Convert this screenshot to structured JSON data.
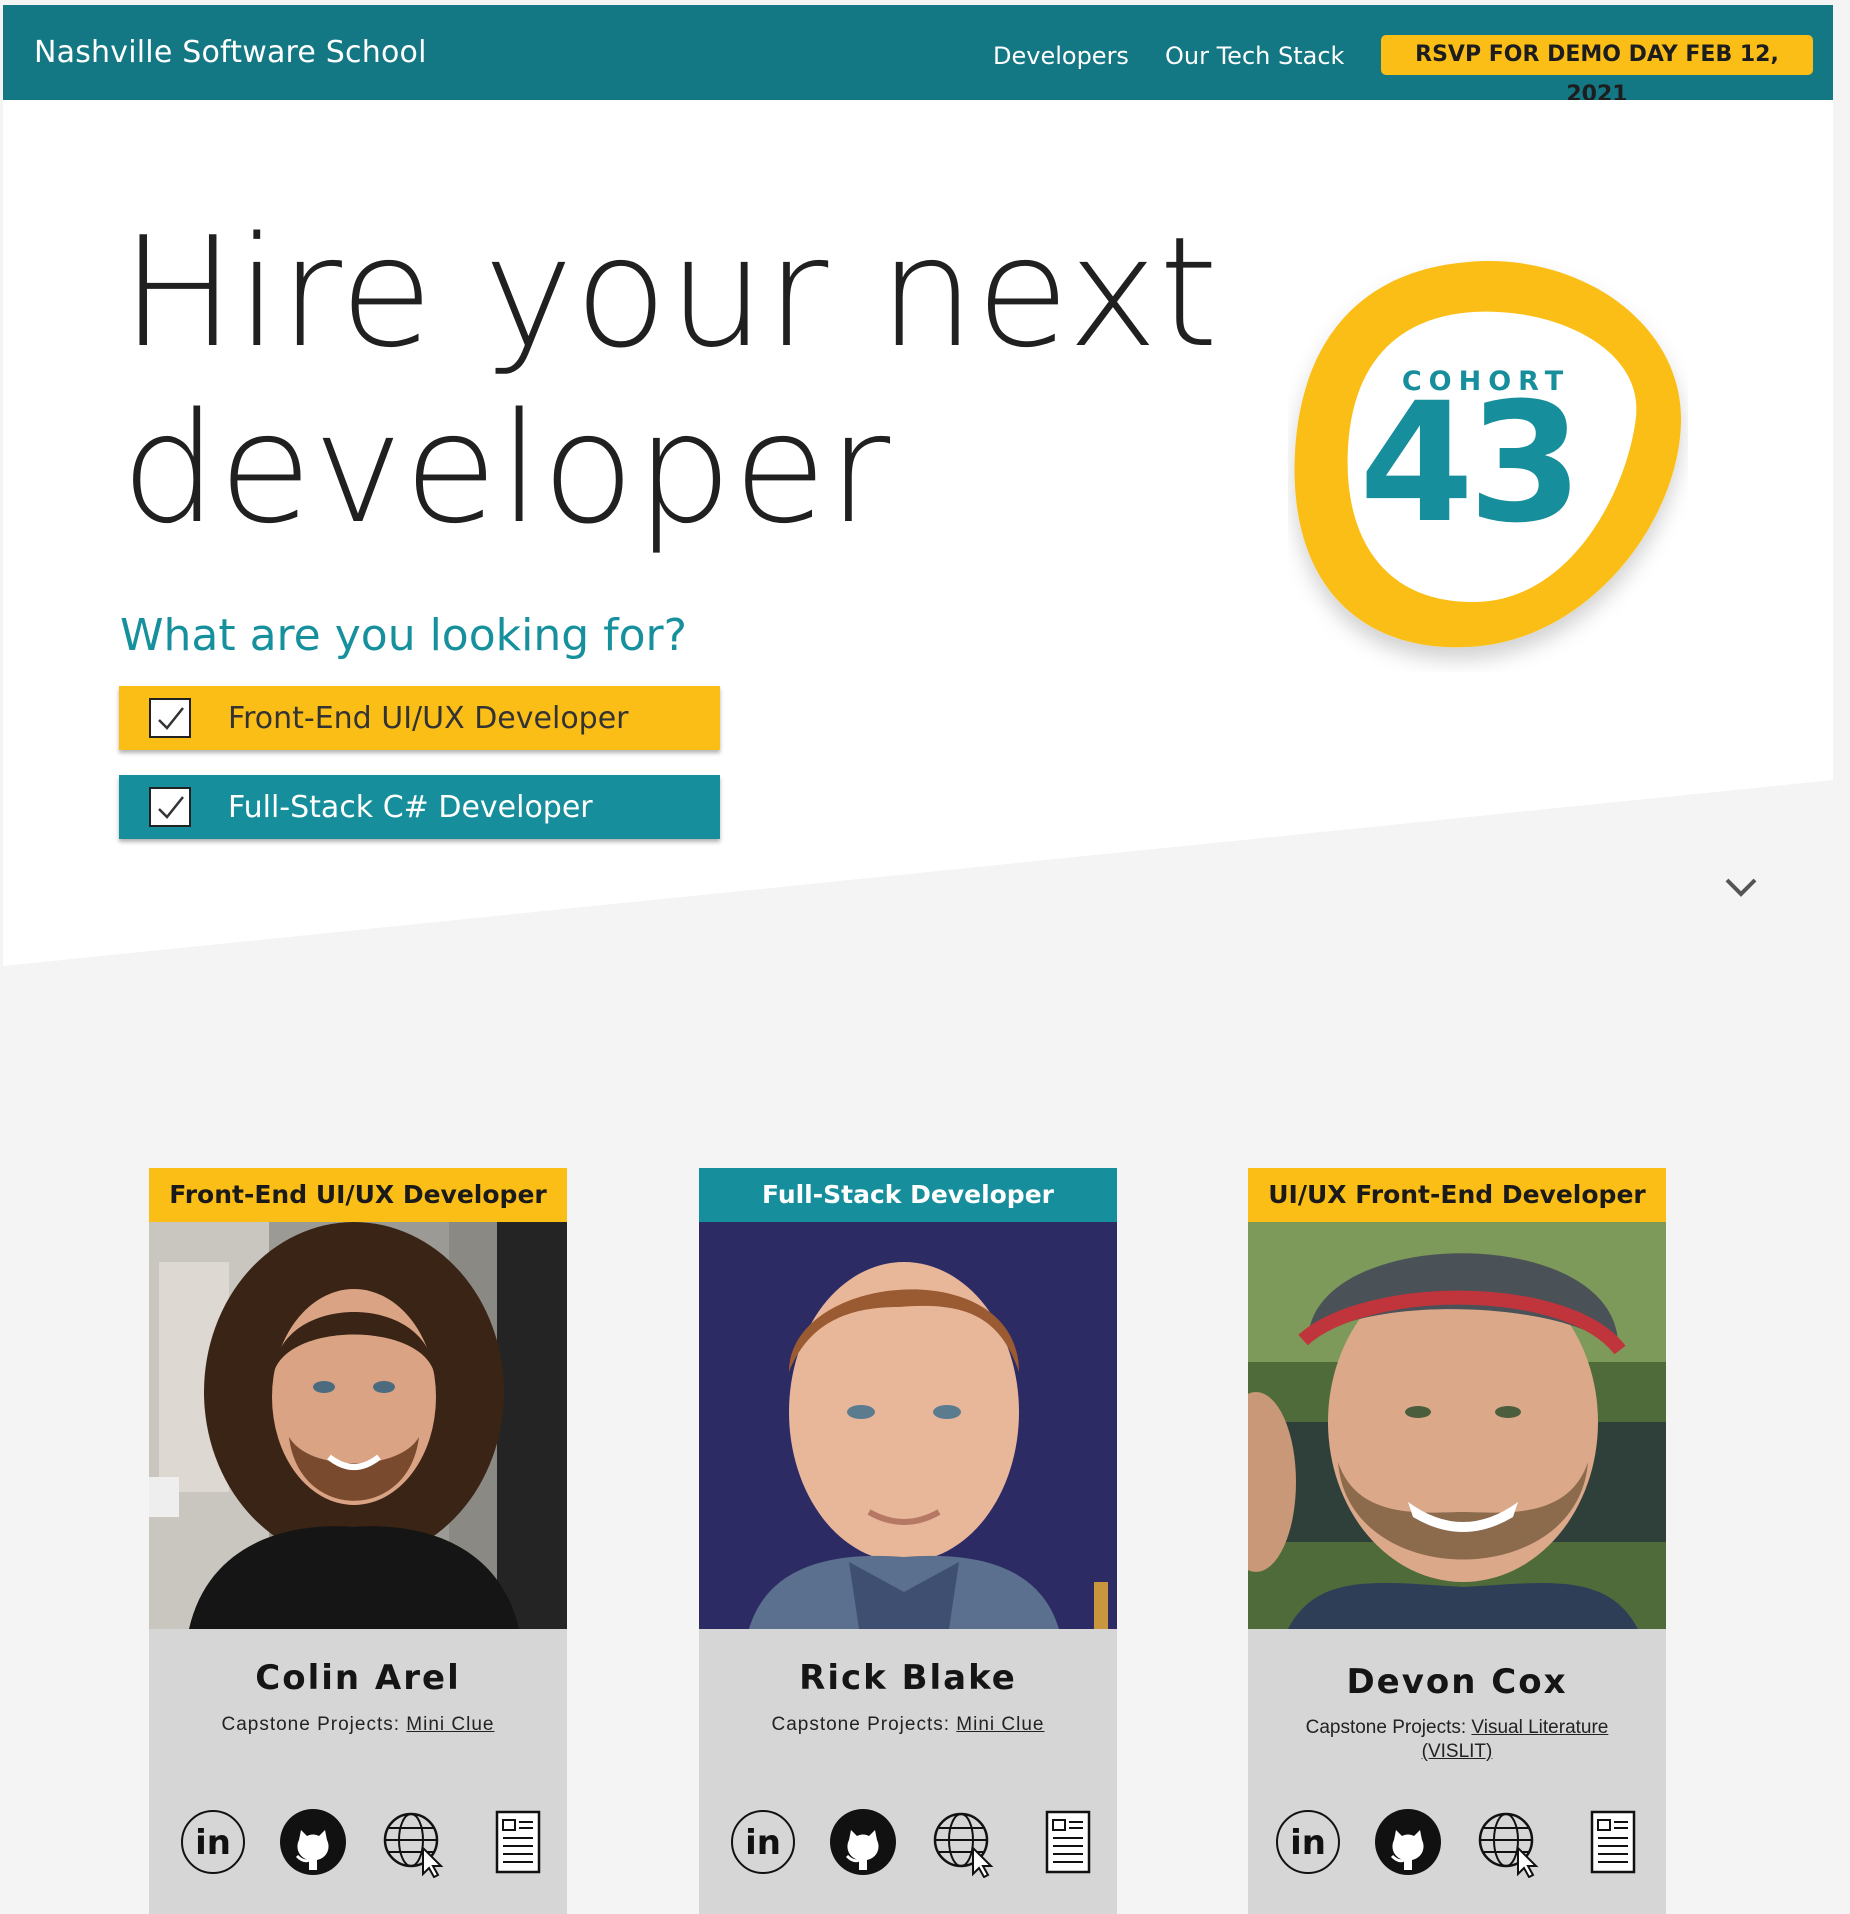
{
  "header": {
    "brand": "Nashville Software School",
    "nav": [
      "Developers",
      "Our Tech Stack"
    ],
    "rsvp_label": "RSVP FOR DEMO DAY FEB 12, 2021"
  },
  "hero": {
    "headline_line1": "Hire your next",
    "headline_line2": "developer",
    "question": "What are you looking for?",
    "filters": [
      {
        "label": "Front-End UI/UX Developer",
        "checked": true,
        "color": "#fbbe17"
      },
      {
        "label": "Full-Stack C# Developer",
        "checked": true,
        "color": "#178e9b"
      }
    ],
    "cohort": {
      "word": "COHORT",
      "number": "43"
    }
  },
  "colors": {
    "teal": "#137884",
    "accent_teal": "#178e9b",
    "yellow": "#fbbe17",
    "card_bg": "#d6d6d6"
  },
  "developers": [
    {
      "role": "Front-End UI/UX Developer",
      "name": "Colin Arel",
      "capstone_prefix": "Capstone Projects:",
      "capstone_link": "Mini Clue",
      "icons": [
        "linkedin-icon",
        "github-icon",
        "website-icon",
        "resume-icon"
      ]
    },
    {
      "role": "Full-Stack Developer",
      "name": "Rick Blake",
      "capstone_prefix": "Capstone Projects:",
      "capstone_link": "Mini Clue",
      "icons": [
        "linkedin-icon",
        "github-icon",
        "website-icon",
        "resume-icon"
      ]
    },
    {
      "role": "UI/UX Front-End Developer",
      "name": "Devon Cox",
      "capstone_prefix": "Capstone Projects:",
      "capstone_link": "Visual Literature (VISLIT)",
      "icons": [
        "linkedin-icon",
        "github-icon",
        "website-icon",
        "resume-icon"
      ]
    }
  ]
}
